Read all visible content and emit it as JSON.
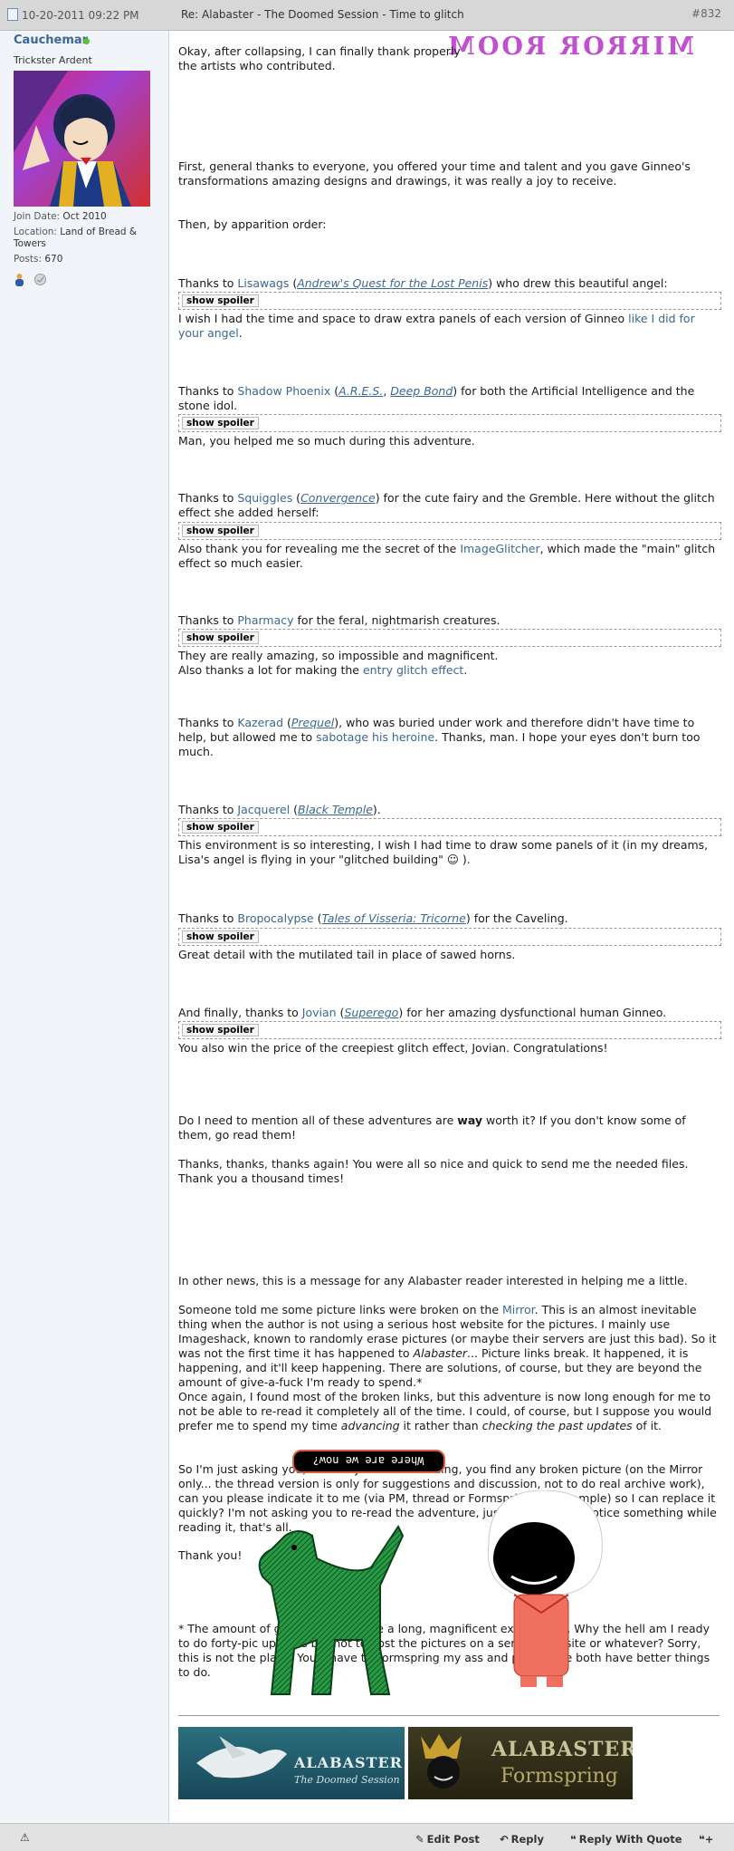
{
  "post": {
    "date": "10-20-2011 09:22 PM",
    "title": "Re: Alabaster - The Doomed Session - Time to glitch",
    "number": "#832"
  },
  "user": {
    "name": "Cauchemar",
    "title": "Trickster Ardent",
    "join_label": "Join Date:",
    "join_value": "Oct 2010",
    "location_label": "Location:",
    "location_value": "Land of Bread & Towers",
    "posts_label": "Posts:",
    "posts_value": "670"
  },
  "overlay": {
    "mirror_text": "MIRROR ROOM",
    "bubble_text": "Where are we now?"
  },
  "body": {
    "p_intro_a": "Okay, after collapsing, I can finally thank properly the artists who contributed.",
    "p_general": "First, general thanks to everyone, you offered your time and talent and you gave Ginneo's transformations amazing designs and drawings, it was really a joy to receive.",
    "p_order": "Then, by apparition order:",
    "lisa": {
      "pre": "Thanks to ",
      "name": "Lisawags",
      "open": " (",
      "work": "Andrew's Quest for the Lost Penis",
      "post": ") who drew this beautiful angel:"
    },
    "lisa_after_a": "I wish I had the time and space to draw extra panels of each version of Ginneo ",
    "lisa_after_link": "like I did for your angel",
    "lisa_after_b": ".",
    "shadow": {
      "pre": "Thanks to ",
      "name": "Shadow Phoenix",
      "open": " (",
      "work1": "A.R.E.S.",
      "sep": ", ",
      "work2": "Deep Bond",
      "post": ") for both the Artificial Intelligence and the stone idol."
    },
    "shadow_after": "Man, you helped me so much during this adventure.",
    "squiggles": {
      "pre": "Thanks to ",
      "name": "Squiggles",
      "open": " (",
      "work": "Convergence",
      "post": ") for the cute fairy and the Gremble. Here without the glitch effect she added herself:"
    },
    "squiggles_after_a": "Also thank you for revealing me the secret of the ",
    "squiggles_after_link": "ImageGlitcher",
    "squiggles_after_b": ", which made the \"main\" glitch effect so much easier.",
    "pharmacy": {
      "pre": "Thanks to ",
      "name": "Pharmacy",
      "post": " for the feral, nightmarish creatures."
    },
    "pharmacy_after_1": "They are really amazing, so impossible and magnificent.",
    "pharmacy_after_2a": "Also thanks a lot for making the ",
    "pharmacy_after_link": "entry glitch effect",
    "pharmacy_after_2b": ".",
    "kazerad": {
      "pre": "Thanks to ",
      "name": "Kazerad",
      "open": " (",
      "work": "Prequel",
      "mid": "), who was buried under work and therefore didn't have time to help, but allowed me to ",
      "link2": "sabotage his heroine",
      "post": ". Thanks, man. I hope your eyes don't burn too much."
    },
    "jacq": {
      "pre": "Thanks to ",
      "name": "Jacquerel",
      "open": " (",
      "work": "Black Temple",
      "post": ")."
    },
    "jacq_after": "This environment is so interesting, I wish I had time to draw some panels of it (in my dreams, Lisa's angel is flying in your \"glitched building\" ☺ ).",
    "bropo": {
      "pre": "Thanks to ",
      "name": "Bropocalypse",
      "open": " (",
      "work": "Tales of Visseria: Tricorne",
      "post": ") for the Caveling."
    },
    "bropo_after": "Great detail with the mutilated tail in place of sawed horns.",
    "jovian": {
      "pre": "And finally, thanks to ",
      "name": "Jovian",
      "open": " (",
      "work": "Superego",
      "post": ") for her amazing dysfunctional human Ginneo."
    },
    "jovian_after": "You also win the price of the creepiest glitch effect, Jovian. Congratulations!",
    "p_mention_a": "Do I need to mention all of these adventures are ",
    "p_mention_b": "way",
    "p_mention_c": " worth it? If you don't know some of them, go read them!",
    "p_thanks": "Thanks, thanks, thanks again! You were all so nice and quick to send me the needed files. Thank you a thousand times!",
    "p_news": "In other news, this is a message for any Alabaster reader interested in helping me a little.",
    "p_told_a": "Someone told me some picture links were broken on the ",
    "p_told_link": "Mirror",
    "p_told_b": ". This is an almost inevitable thing when the author is not using a serious host website for the pictures. I mainly use Imageshack, known to randomly erase pictures (or maybe their servers are just this bad). So it was not the first time it has happened to ",
    "p_told_it": "Alabaster",
    "p_told_c": "... Picture links break. It happened, it is happening, and it'll keep happening. There are solutions, of course, but they are beyond the amount of give-a-fuck I'm ready to spend.*",
    "p_once_a": "Once again, I found most of the broken links, but this adventure is now long enough for me to not be able to re-read it completely all of the time. I could, of course, but I suppose you would prefer me to spend my time ",
    "p_once_it1": "advancing",
    "p_once_b": " it rather than ",
    "p_once_it2": "checking the past updates",
    "p_once_c": " of it.",
    "p_ask": "So I'm just asking you, if while you are re-reading, you find any broken picture (on the Mirror only... the thread version is only for suggestions and discussion, not to do real archive work), can you please indicate it to me (via PM, thread or Formspring, for example) so I can replace it quickly? I'm not asking you to re-read the adventure, just tell me if you notice something while reading it, that's all.",
    "p_thankyou": "Thank you!",
    "p_foot": "* The amount of give-a-fuck is a use a long, magnificent explanation. Why the hell am I ready to do forty-pic updates but not to host the pictures on a serious website or whatever? Sorry, this is not the place. You'll have to Formspring my ass and please, we both have better things to do.",
    "spoiler_label": "show spoiler"
  },
  "banners": {
    "b1_title": "ALABASTER",
    "b1_sub": "The Doomed Session",
    "b2_title": "ALABASTER",
    "b2_sub": "Formspring"
  },
  "footer": {
    "edit": "Edit Post",
    "reply": "Reply",
    "quote": "Reply With Quote"
  },
  "colors": {
    "link": "#3c6794",
    "sidebar_bg": "#f1f5fa",
    "header_bg": "#d7d7d7",
    "mirror_text": "#c050d0"
  }
}
